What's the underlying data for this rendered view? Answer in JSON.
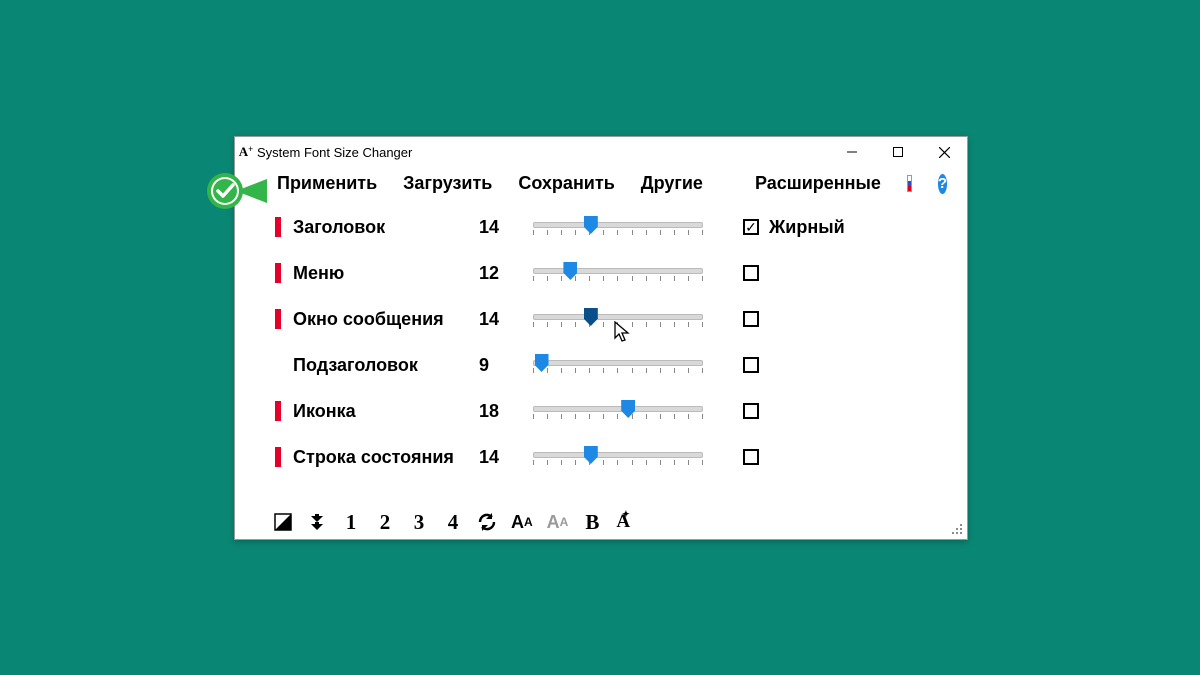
{
  "window": {
    "title": "System Font Size Changer"
  },
  "menu": {
    "apply": "Применить",
    "load": "Загрузить",
    "save": "Сохранить",
    "other": "Другие",
    "advanced": "Расширенные"
  },
  "bold_label": "Жирный",
  "rows": [
    {
      "label": "Заголовок",
      "value": "14",
      "pos": 34,
      "dirty": true,
      "bold": true,
      "active": false
    },
    {
      "label": "Меню",
      "value": "12",
      "pos": 22,
      "dirty": true,
      "bold": false,
      "active": false
    },
    {
      "label": "Окно сообщения",
      "value": "14",
      "pos": 34,
      "dirty": true,
      "bold": false,
      "active": true
    },
    {
      "label": "Подзаголовок",
      "value": "9",
      "pos": 5,
      "dirty": false,
      "bold": false,
      "active": false
    },
    {
      "label": "Иконка",
      "value": "18",
      "pos": 56,
      "dirty": true,
      "bold": false,
      "active": false
    },
    {
      "label": "Строка состояния",
      "value": "14",
      "pos": 34,
      "dirty": true,
      "bold": false,
      "active": false
    }
  ],
  "toolbar": {
    "presets": [
      "1",
      "2",
      "3",
      "4"
    ],
    "bold": "B",
    "aplus": "A"
  }
}
